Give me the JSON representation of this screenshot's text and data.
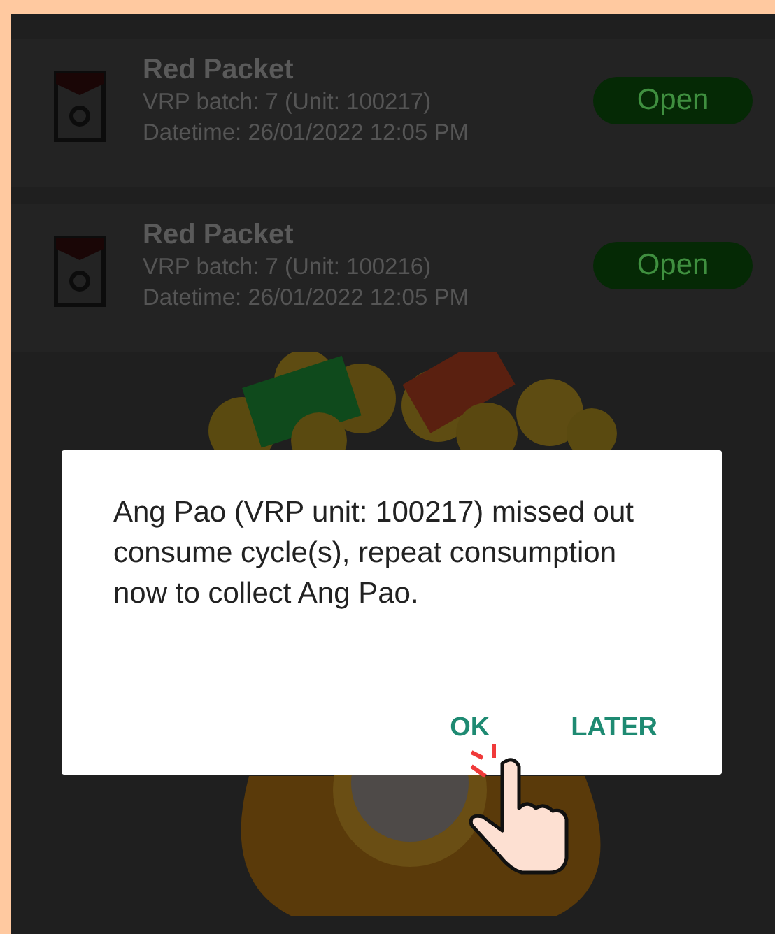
{
  "packets": [
    {
      "title": "Red Packet",
      "batch": "VRP batch: 7 (Unit: 100217)",
      "datetime": "Datetime: 26/01/2022 12:05 PM",
      "button": "Open"
    },
    {
      "title": "Red Packet",
      "batch": "VRP batch: 7 (Unit: 100216)",
      "datetime": "Datetime: 26/01/2022 12:05 PM",
      "button": "Open"
    }
  ],
  "dialog": {
    "message": "Ang Pao (VRP unit: 100217) missed out consume cycle(s), repeat consumption now to collect Ang Pao.",
    "buttons": [
      "OK",
      "LATER"
    ]
  }
}
